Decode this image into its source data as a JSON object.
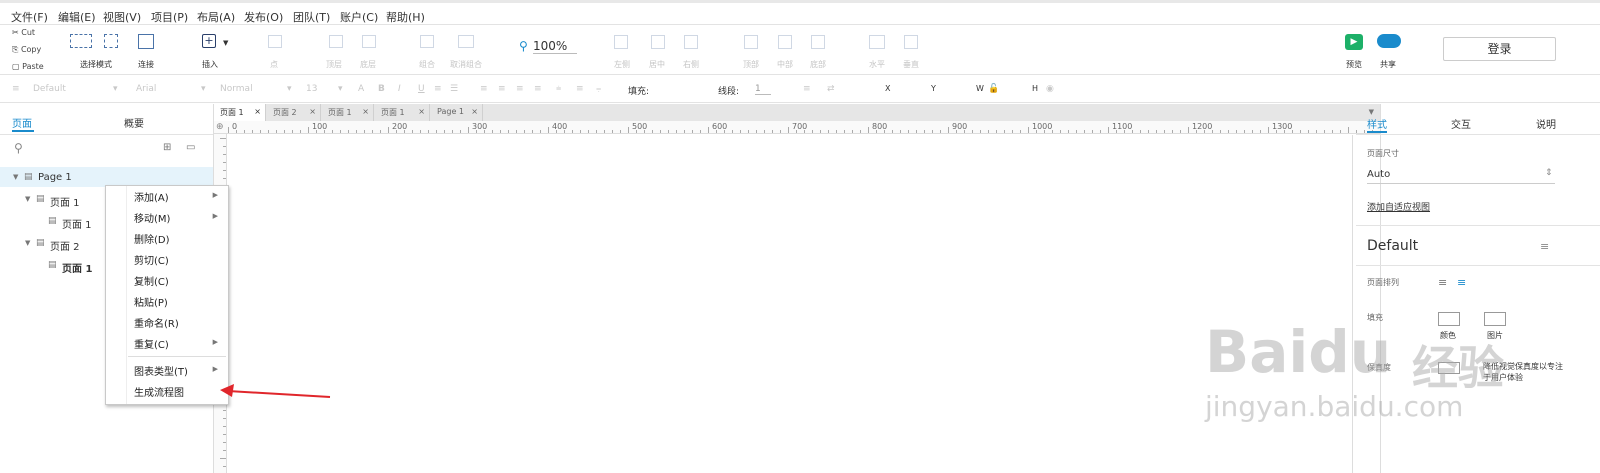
{
  "menu": [
    "文件(F)",
    "编辑(E)",
    "视图(V)",
    "项目(P)",
    "布局(A)",
    "发布(O)",
    "团队(T)",
    "账户(C)",
    "帮助(H)"
  ],
  "clipboard": {
    "cut": "Cut",
    "copy": "Copy",
    "paste": "Paste"
  },
  "toolbar": {
    "select_mode": "选择模式",
    "connect": "连接",
    "insert": "插入",
    "point": "点",
    "top": "顶层",
    "bottom": "底层",
    "group": "组合",
    "ungroup": "取消组合",
    "zoom": "100%",
    "align_left": "左侧",
    "align_center": "居中",
    "align_right": "右侧",
    "align_top": "顶部",
    "align_middle": "中部",
    "align_bottom": "底部",
    "horizontal": "水平",
    "vertical": "垂直",
    "preview": "预览",
    "share": "共享",
    "login": "登录"
  },
  "toolbar2": {
    "style": "Default",
    "font": "Arial",
    "weight": "Normal",
    "size": "13",
    "fill": "填充:",
    "line": "线段:",
    "line_val": "1",
    "x": "X",
    "y": "Y",
    "w": "W",
    "h": "H"
  },
  "left": {
    "tab_pages": "页面",
    "tab_outline": "概要"
  },
  "tree": [
    "Page 1",
    "页面 1",
    "页面 1",
    "页面 2",
    "页面 1"
  ],
  "context_menu": [
    {
      "label": "添加(A)",
      "sub": true
    },
    {
      "label": "移动(M)",
      "sub": true
    },
    {
      "label": "删除(D)",
      "sub": false
    },
    {
      "label": "剪切(C)",
      "sub": false
    },
    {
      "label": "复制(C)",
      "sub": false
    },
    {
      "label": "粘贴(P)",
      "sub": false
    },
    {
      "label": "重命名(R)",
      "sub": false
    },
    {
      "label": "重复(C)",
      "sub": true
    },
    {
      "label": "图表类型(T)",
      "sub": true
    },
    {
      "label": "生成流程图",
      "sub": false
    }
  ],
  "page_tabs": [
    "页面 1",
    "页面 2",
    "页面 1",
    "页面 1",
    "Page 1"
  ],
  "ruler": [
    "0",
    "100",
    "200",
    "300",
    "400",
    "500",
    "600",
    "700",
    "800",
    "900",
    "1000",
    "1100",
    "1200",
    "1300"
  ],
  "right": {
    "tab_style": "样式",
    "tab_interact": "交互",
    "tab_notes": "说明",
    "page_size_label": "页面尺寸",
    "page_size": "Auto",
    "adaptive_link": "添加自适应视图",
    "default": "Default",
    "page_align": "页面排列",
    "fill": "填充",
    "color": "颜色",
    "image": "图片",
    "lowfi_label": "保真度",
    "lowfi_text1": "降低视觉保真度以专注",
    "lowfi_text2": "于用户体验"
  },
  "watermark": {
    "brand": "Baidu",
    "brand_cn": "经验",
    "url": "jingyan.baidu.com"
  },
  "colors": {
    "accent": "#1a8bcc",
    "arrow": "#e0262b",
    "selection": "#e5f3fb"
  }
}
